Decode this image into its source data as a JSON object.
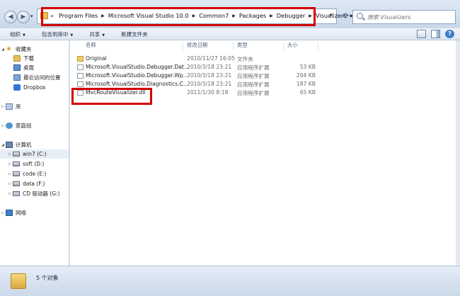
{
  "navigation": {
    "back_icon": "back-arrow-icon",
    "forward_icon": "forward-arrow-icon"
  },
  "address_bar": {
    "prefix": "«",
    "breadcrumbs": [
      "Program Files",
      "Microsoft Visual Studio 10.0",
      "Common7",
      "Packages",
      "Debugger",
      "Visualizers"
    ]
  },
  "search": {
    "placeholder": "搜索 Visualizers"
  },
  "toolbar": {
    "organize": "组织",
    "include_in_library": "包含到库中",
    "share": "共享",
    "new_folder": "新建文件夹"
  },
  "sidebar": {
    "favorites": "收藏夹",
    "downloads": "下载",
    "desktop": "桌面",
    "recent": "最近访问的位置",
    "dropbox": "Dropbox",
    "libraries": "库",
    "homegroup": "家庭组",
    "computer": "计算机",
    "drives": [
      "win7 (C:)",
      "soft (D:)",
      "code (E:)",
      "data (F:)",
      "CD 驱动器 (G:)"
    ],
    "network": "网络"
  },
  "columns": {
    "name": "名称",
    "date_modified": "修改日期",
    "type": "类型",
    "size": "大小"
  },
  "files": [
    {
      "name": "Original",
      "date": "2010/11/27 16:05",
      "type": "文件夹",
      "size": "",
      "icon": "folder-icon"
    },
    {
      "name": "Microsoft.VisualStudio.Debugger.Dat...",
      "date": "2010/3/18 23:21",
      "type": "应用程序扩展",
      "size": "53 KB",
      "icon": "dll-file-icon"
    },
    {
      "name": "Microsoft.VisualStudio.Debugger.Wp...",
      "date": "2010/3/18 23:21",
      "type": "应用程序扩展",
      "size": "204 KB",
      "icon": "dll-file-icon"
    },
    {
      "name": "Microsoft.VisualStudio.Diagnostics.C...",
      "date": "2010/3/18 23:21",
      "type": "应用程序扩展",
      "size": "187 KB",
      "icon": "dll-file-icon"
    },
    {
      "name": "MvcRouteVisualizer.dll",
      "date": "2011/1/30 8:18",
      "type": "应用程序扩展",
      "size": "65 KB",
      "icon": "dll-file-icon"
    }
  ],
  "status_bar": {
    "item_count": "5 个对象"
  },
  "colors": {
    "highlight_box": "#d40000",
    "window_chrome": "#cfdceb"
  }
}
